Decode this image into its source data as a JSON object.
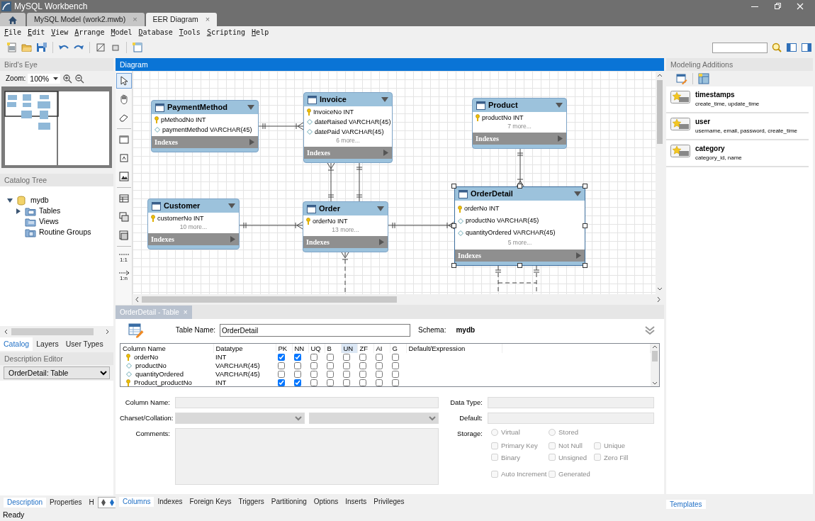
{
  "window": {
    "title": "MySQL Workbench"
  },
  "document_tabs": [
    {
      "label": "MySQL Model (work2.mwb)",
      "close": "×",
      "selected": false
    },
    {
      "label": "EER Diagram",
      "close": "×",
      "selected": true
    }
  ],
  "menu": [
    "File",
    "Edit",
    "View",
    "Arrange",
    "Model",
    "Database",
    "Tools",
    "Scripting",
    "Help"
  ],
  "birds_eye": {
    "title": "Bird's Eye",
    "zoom_label": "Zoom:",
    "zoom_value": "100%"
  },
  "catalog": {
    "title": "Catalog Tree",
    "tree": [
      {
        "label": "mydb",
        "kind": "schema",
        "expanded": true,
        "children": [
          {
            "label": "Tables",
            "kind": "tables",
            "expanded": false
          },
          {
            "label": "Views",
            "kind": "views"
          },
          {
            "label": "Routine Groups",
            "kind": "routines"
          }
        ]
      }
    ]
  },
  "side_tabs": [
    {
      "label": "Catalog",
      "selected": true
    },
    {
      "label": "Layers",
      "selected": false
    },
    {
      "label": "User Types",
      "selected": false
    }
  ],
  "description_editor": {
    "title": "Description Editor",
    "value": "OrderDetail: Table"
  },
  "bottom_tabs": [
    {
      "label": "Description",
      "selected": true
    },
    {
      "label": "Properties",
      "selected": false
    },
    {
      "label": "H",
      "selected": false
    }
  ],
  "diagram": {
    "title": "Diagram",
    "tools": [
      {
        "kind": "pointer",
        "selected": true
      },
      {
        "kind": "hand",
        "selected": false
      },
      {
        "kind": "eraser",
        "selected": false
      },
      {
        "kind": "layer",
        "selected": false
      },
      {
        "kind": "note",
        "selected": false
      },
      {
        "kind": "image",
        "selected": false
      },
      {
        "kind": "table",
        "selected": false
      },
      {
        "kind": "view",
        "selected": false
      },
      {
        "kind": "routine_group",
        "selected": false
      },
      {
        "kind": "relation",
        "label": "1:1",
        "selected": false
      },
      {
        "kind": "relation",
        "label": "1:n",
        "selected": false
      }
    ],
    "tables": [
      {
        "name": "PaymentMethod",
        "selected": false,
        "columns": [
          {
            "text": "pMethodNo INT",
            "kind": "pk"
          },
          {
            "text": "paymentMethod VARCHAR(45)",
            "kind": "column"
          }
        ],
        "indexes": "Indexes"
      },
      {
        "name": "Invoice",
        "selected": false,
        "columns": [
          {
            "text": "InvoiceNo INT",
            "kind": "pk"
          },
          {
            "text": "dateRaised VARCHAR(45)",
            "kind": "column"
          },
          {
            "text": "datePaid VARCHAR(45)",
            "kind": "column"
          }
        ],
        "more": "6 more...",
        "indexes": "Indexes"
      },
      {
        "name": "Product",
        "selected": false,
        "columns": [
          {
            "text": "productNo INT",
            "kind": "pk"
          }
        ],
        "more": "7 more...",
        "indexes": "Indexes"
      },
      {
        "name": "Customer",
        "selected": false,
        "columns": [
          {
            "text": "customerNo INT",
            "kind": "pk"
          }
        ],
        "more": "10 more...",
        "indexes": "Indexes"
      },
      {
        "name": "Order",
        "selected": false,
        "columns": [
          {
            "text": "orderNo INT",
            "kind": "pk"
          }
        ],
        "more": "13 more...",
        "indexes": "Indexes"
      },
      {
        "name": "OrderDetail",
        "selected": true,
        "columns": [
          {
            "text": "orderNo INT",
            "kind": "pk"
          },
          {
            "text": "productNo VARCHAR(45)",
            "kind": "column"
          },
          {
            "text": "quantityOrdered VARCHAR(45)",
            "kind": "column"
          }
        ],
        "more": "5 more...",
        "indexes": "Indexes"
      }
    ],
    "relationships": [
      {
        "kind": "identifying"
      },
      {
        "kind": "identifying"
      },
      {
        "kind": "identifying"
      },
      {
        "kind": "identifying"
      },
      {
        "kind": "identifying"
      },
      {
        "kind": "identifying"
      },
      {
        "kind": "non_identifying"
      },
      {
        "kind": "non_identifying"
      }
    ]
  },
  "table_editor": {
    "tab": {
      "label": "OrderDetail - Table",
      "close": "×"
    },
    "table_name_label": "Table Name:",
    "table_name": "OrderDetail",
    "schema_label": "Schema:",
    "schema": "mydb",
    "grid": {
      "columns": [
        {
          "label": "Column Name",
          "highlighted": false
        },
        {
          "label": "Datatype",
          "highlighted": false
        },
        {
          "label": "PK",
          "highlighted": false
        },
        {
          "label": "NN",
          "highlighted": false
        },
        {
          "label": "UQ",
          "highlighted": false
        },
        {
          "label": "B",
          "highlighted": false
        },
        {
          "label": "UN",
          "highlighted": true
        },
        {
          "label": "ZF",
          "highlighted": false
        },
        {
          "label": "AI",
          "highlighted": false
        },
        {
          "label": "G",
          "highlighted": false
        },
        {
          "label": "Default/Expression",
          "highlighted": false
        }
      ],
      "rows": [
        {
          "name": "orderNo",
          "kind": "pk",
          "datatype": "INT",
          "flags": [
            true,
            true,
            false,
            false,
            false,
            false,
            false,
            false
          ]
        },
        {
          "name": "productNo",
          "kind": "column",
          "datatype": "VARCHAR(45)",
          "flags": [
            false,
            false,
            false,
            false,
            false,
            false,
            false,
            false
          ]
        },
        {
          "name": "quantityOrdered",
          "kind": "column",
          "datatype": "VARCHAR(45)",
          "flags": [
            false,
            false,
            false,
            false,
            false,
            false,
            false,
            false
          ]
        },
        {
          "name": "Product_productNo",
          "kind": "pk",
          "datatype": "INT",
          "flags": [
            true,
            true,
            false,
            false,
            false,
            false,
            false,
            false
          ]
        }
      ]
    },
    "details": {
      "disabled": true,
      "column_name_label": "Column Name:",
      "charset_label": "Charset/Collation:",
      "comments_label": "Comments:",
      "data_type_label": "Data Type:",
      "default_label": "Default:",
      "storage_label": "Storage:",
      "storage": [
        {
          "label": "Virtual",
          "selected": false
        },
        {
          "label": "Stored",
          "selected": false
        }
      ],
      "options": [
        {
          "label": "Primary Key",
          "checked": false
        },
        {
          "label": "Not Null",
          "checked": false
        },
        {
          "label": "Unique",
          "checked": false
        },
        {
          "label": "Binary",
          "checked": false
        },
        {
          "label": "Unsigned",
          "checked": false
        },
        {
          "label": "Zero Fill",
          "checked": false
        },
        {
          "label": "Auto Increment",
          "checked": false
        },
        {
          "label": "Generated",
          "checked": false
        }
      ]
    },
    "tabs": [
      {
        "label": "Columns",
        "selected": true
      },
      {
        "label": "Indexes",
        "selected": false
      },
      {
        "label": "Foreign Keys",
        "selected": false
      },
      {
        "label": "Triggers",
        "selected": false
      },
      {
        "label": "Partitioning",
        "selected": false
      },
      {
        "label": "Options",
        "selected": false
      },
      {
        "label": "Inserts",
        "selected": false
      },
      {
        "label": "Privileges",
        "selected": false
      }
    ]
  },
  "modeling_additions": {
    "title": "Modeling Additions",
    "templates": [
      {
        "name": "timestamps",
        "columns": "create_time, update_time"
      },
      {
        "name": "user",
        "columns": "username, email, password, create_time"
      },
      {
        "name": "category",
        "columns": "category_id, name"
      }
    ],
    "tab": {
      "label": "Templates",
      "selected": true
    }
  },
  "status_bar": {
    "text": "Ready"
  }
}
